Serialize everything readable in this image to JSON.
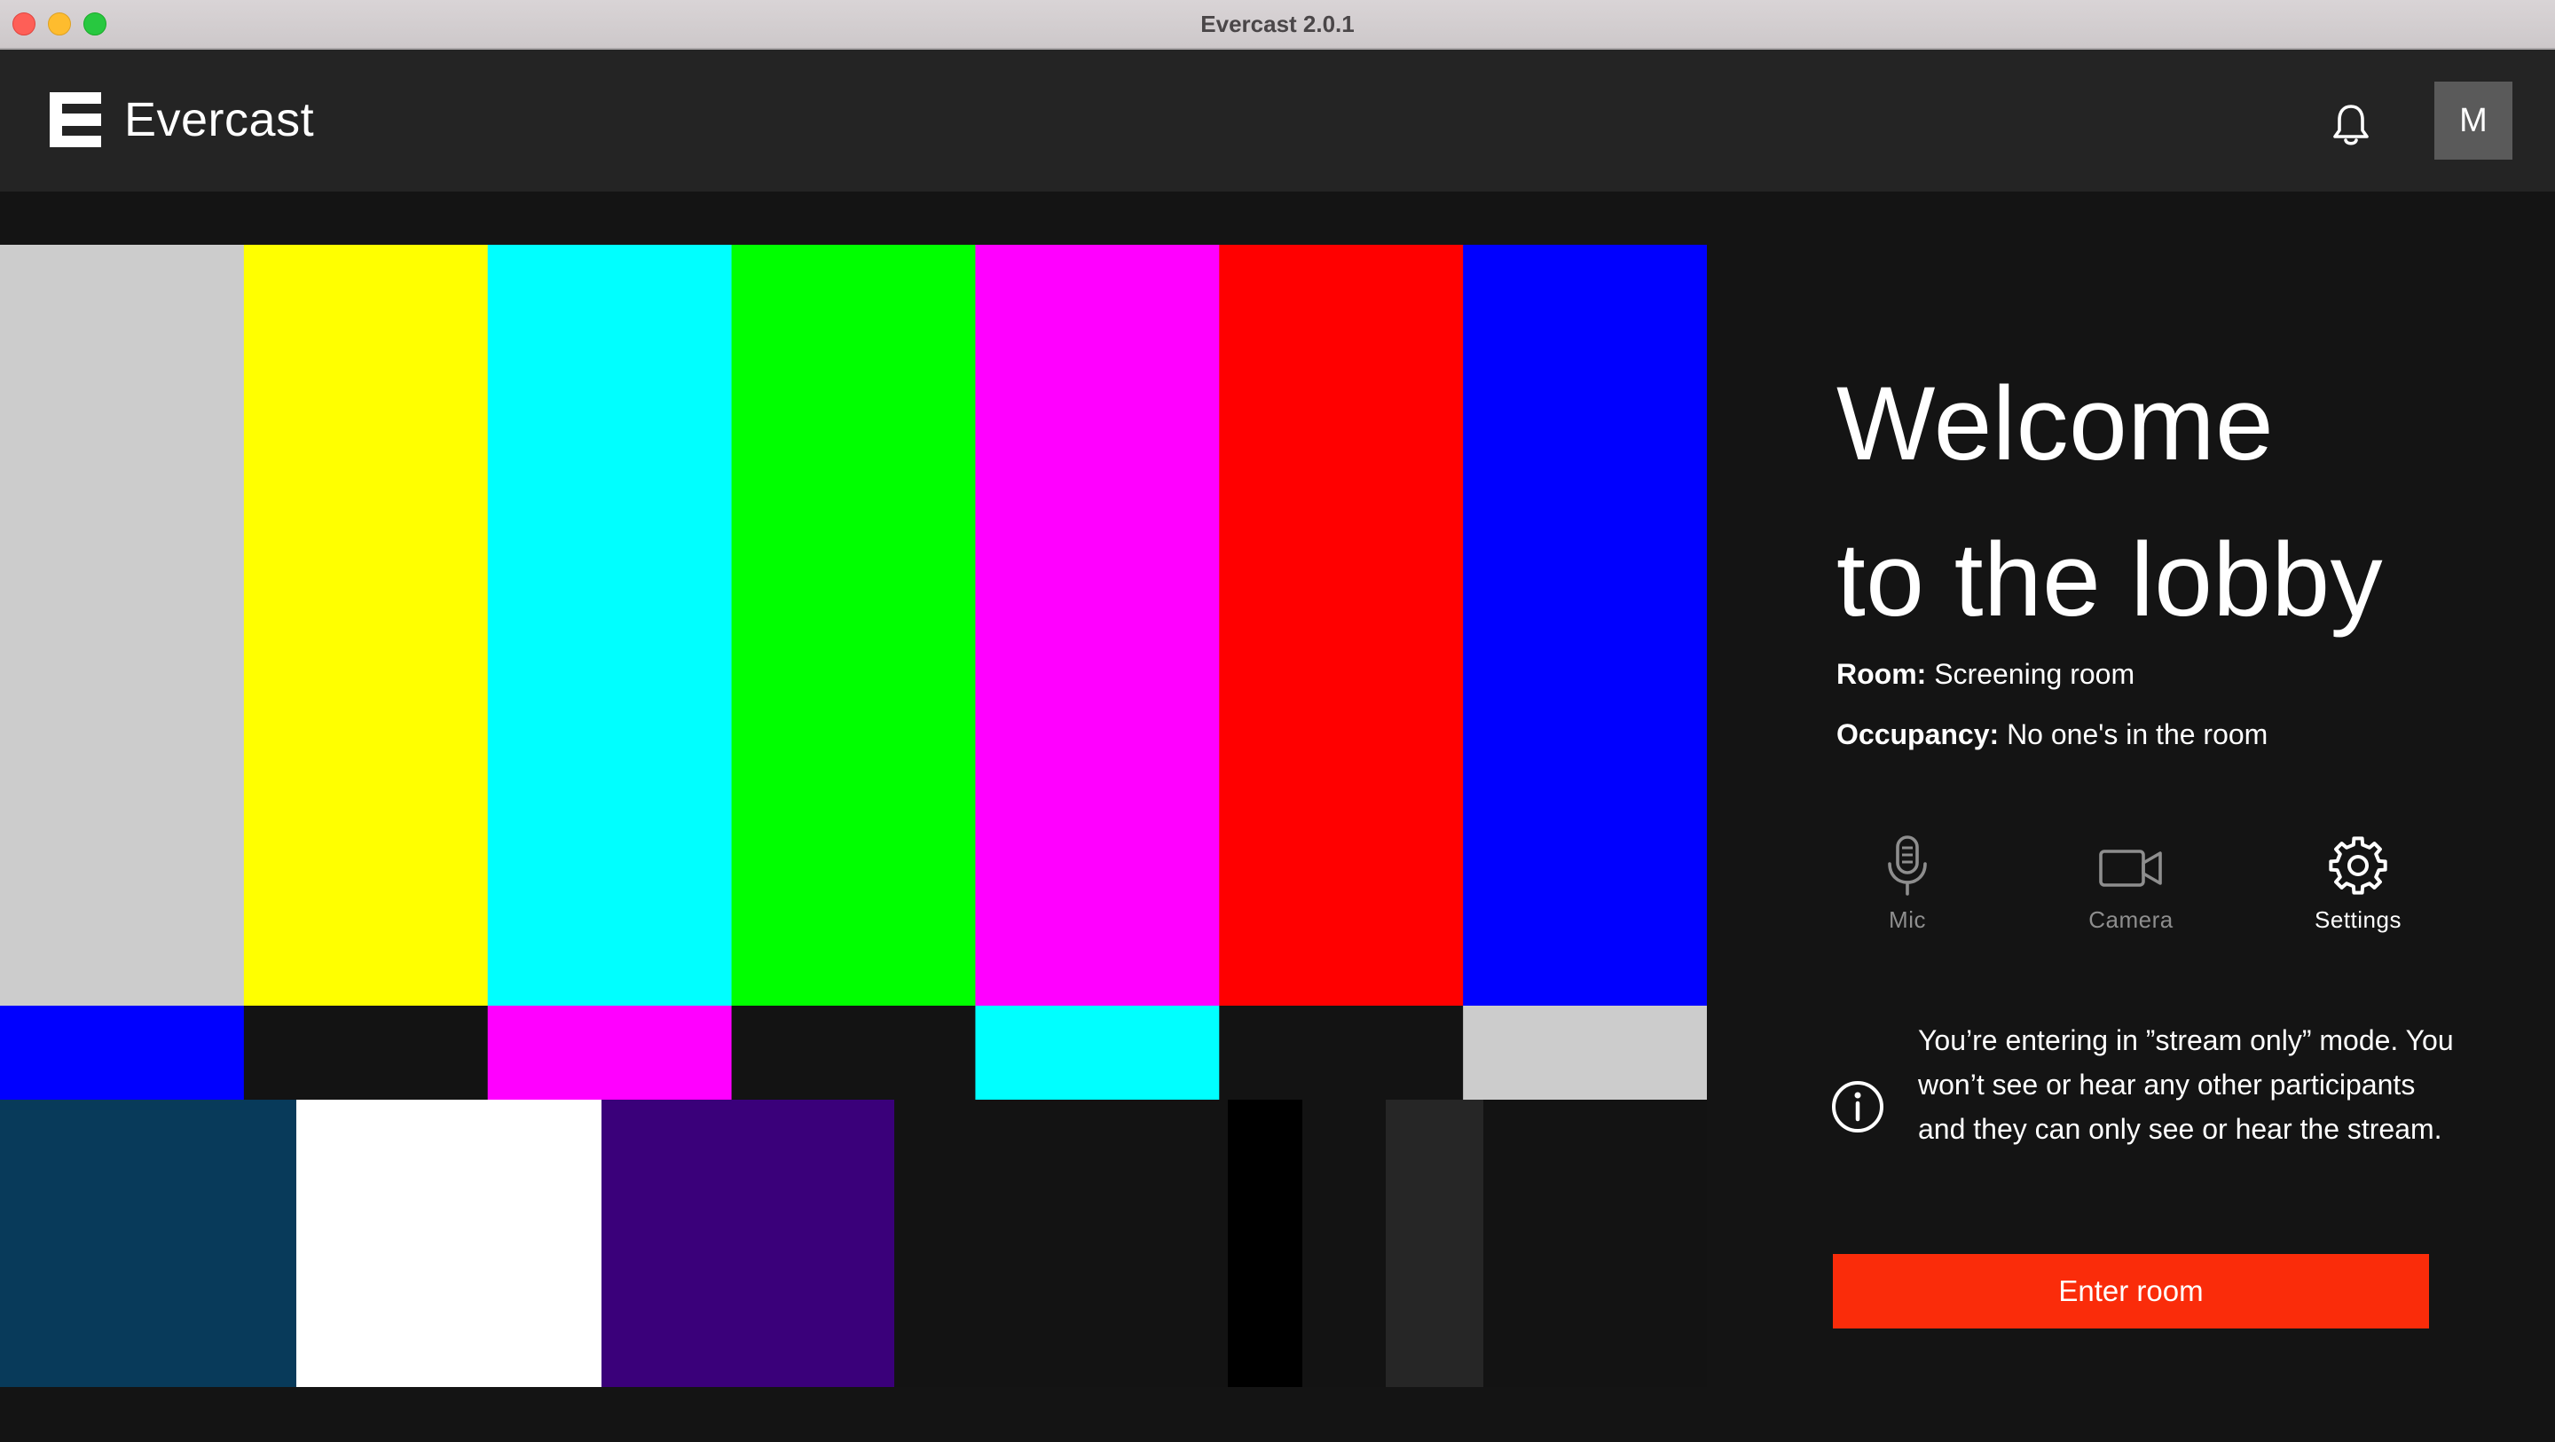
{
  "window": {
    "title": "Evercast 2.0.1"
  },
  "header": {
    "brand": "Evercast",
    "notifications_icon": "bell-icon",
    "avatar_initial": "M"
  },
  "video_preview": {
    "content": "color-bars-test-pattern",
    "top_bars": [
      "#cccccc",
      "#ffff00",
      "#00ffff",
      "#00ff00",
      "#ff00ff",
      "#ff0000",
      "#0000ff"
    ],
    "middle_bars": [
      "#0000ff",
      "#131313",
      "#ff00ff",
      "#131313",
      "#00ffff",
      "#131313",
      "#cccccc"
    ],
    "bottom_blocks": [
      "#083a5a",
      "#ffffff",
      "#3a007a",
      "#131313",
      "#000000",
      "#131313",
      "#262626",
      "#131313"
    ]
  },
  "lobby": {
    "title_line1": "Welcome",
    "title_line2": "to the lobby",
    "room_label": "Room:",
    "room_value": "Screening room",
    "occupancy_label": "Occupancy:",
    "occupancy_value": "No one's in the room"
  },
  "controls": [
    {
      "label": "Mic",
      "icon": "microphone-icon",
      "enabled": false
    },
    {
      "label": "Camera",
      "icon": "video-camera-icon",
      "enabled": false
    },
    {
      "label": "Settings",
      "icon": "gear-icon",
      "enabled": true
    }
  ],
  "notice": {
    "icon": "info-icon",
    "text": "You’re entering in ”stream only” mode. You won’t see or hear any other participants and they can only see or hear the stream."
  },
  "enter_button": {
    "label": "Enter room",
    "color": "#fa2c0a"
  }
}
